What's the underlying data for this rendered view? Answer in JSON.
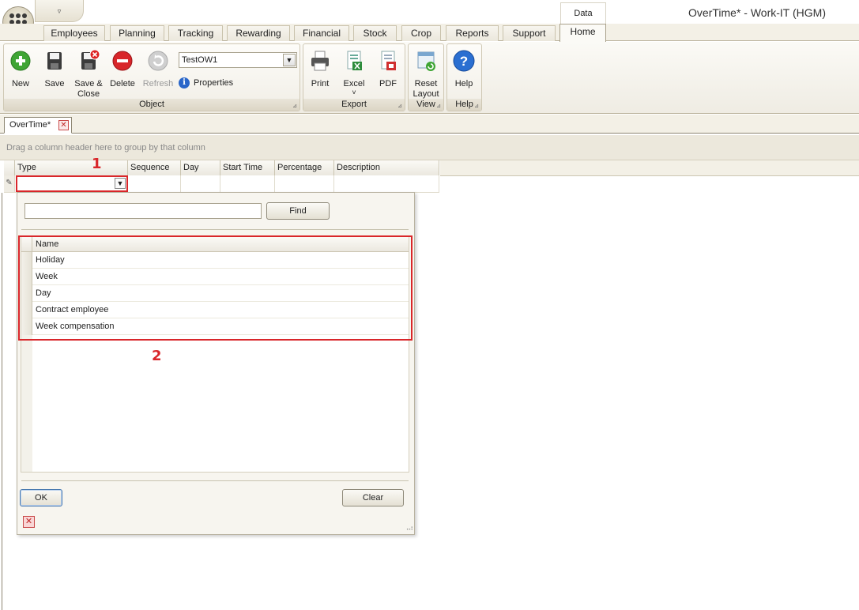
{
  "window": {
    "title": "OverTime* - Work-IT (HGM)",
    "qat_glyph": "▿"
  },
  "context_tab": "Data",
  "tabs": [
    {
      "label": "Employees"
    },
    {
      "label": "Planning"
    },
    {
      "label": "Tracking"
    },
    {
      "label": "Rewarding"
    },
    {
      "label": "Financial"
    },
    {
      "label": "Stock"
    },
    {
      "label": "Crop"
    },
    {
      "label": "Reports"
    },
    {
      "label": "Support"
    },
    {
      "label": "Home"
    }
  ],
  "ribbon": {
    "object_group": "Object",
    "export_group": "Export",
    "view_group": "View",
    "help_group": "Help",
    "new": "New",
    "save": "Save",
    "save_close_1": "Save &",
    "save_close_2": "Close",
    "delete": "Delete",
    "refresh": "Refresh",
    "combo_value": "TestOW1",
    "properties": "Properties",
    "print": "Print",
    "excel": "Excel",
    "excel_arrow": "˅",
    "pdf": "PDF",
    "reset_layout_1": "Reset",
    "reset_layout_2": "Layout",
    "help": "Help",
    "launcher": "⊿"
  },
  "document_tab": {
    "label": "OverTime*"
  },
  "group_panel_hint": "Drag a column header here to group by that column",
  "grid": {
    "columns": [
      "Type",
      "Sequence",
      "Day",
      "Start Time",
      "Percentage",
      "Description"
    ],
    "edit_row_indicator": "✎"
  },
  "popup": {
    "find_value": "",
    "find_label": "Find",
    "column_header": "Name",
    "items": [
      "Holiday",
      "Week",
      "Day",
      "Contract employee",
      "Week compensation"
    ],
    "ok_label": "OK",
    "clear_label": "Clear",
    "grip": "⠠⠴"
  },
  "annotations": {
    "one": "1",
    "two": "2",
    "color": "#d9262a"
  }
}
